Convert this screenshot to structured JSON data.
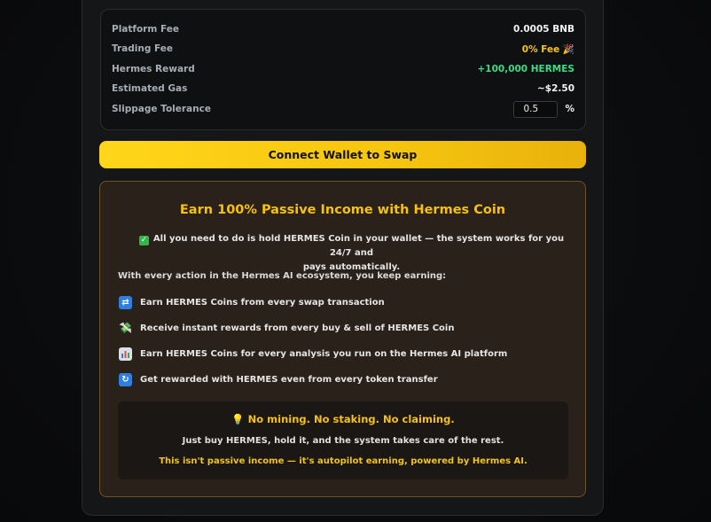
{
  "fees": {
    "rows": [
      {
        "label": "Platform Fee",
        "value": "0.0005 BNB"
      },
      {
        "label": "Trading Fee",
        "value": "0% Fee 🎉"
      },
      {
        "label": "Hermes Reward",
        "value": "+100,000 HERMES"
      },
      {
        "label": "Estimated Gas",
        "value": "~$2.50"
      }
    ],
    "slippage": {
      "label": "Slippage Tolerance",
      "value": "0.5",
      "unit": "%"
    }
  },
  "connect_label": "Connect Wallet to Swap",
  "earn": {
    "title": "Earn 100% Passive Income with Hermes Coin",
    "intro_line1": "All you need to do is hold HERMES Coin in your wallet — the system works for you 24/7 and",
    "intro_line2": "pays automatically.",
    "lead": "With every action in the Hermes AI ecosystem, you keep earning:",
    "bullets": [
      {
        "icon": "swap-arrows-icon",
        "text": "Earn HERMES Coins from every swap transaction"
      },
      {
        "icon": "money-wings-icon",
        "text": "Receive instant rewards from every buy & sell of HERMES Coin"
      },
      {
        "icon": "bar-chart-icon",
        "text": "Earn HERMES Coins for every analysis you run on the Hermes AI platform"
      },
      {
        "icon": "refresh-icon",
        "text": "Get rewarded with HERMES even from every token transfer"
      }
    ],
    "notice": {
      "title": "No mining. No staking. No claiming.",
      "body": "Just buy HERMES, hold it, and the system takes care of the rest.",
      "foot": "This isn't passive income — it's autopilot earning, powered by Hermes AI."
    }
  },
  "colors": {
    "accent": "#f6c10f",
    "reward": "#3ddc84",
    "panel": "#2a211a"
  }
}
